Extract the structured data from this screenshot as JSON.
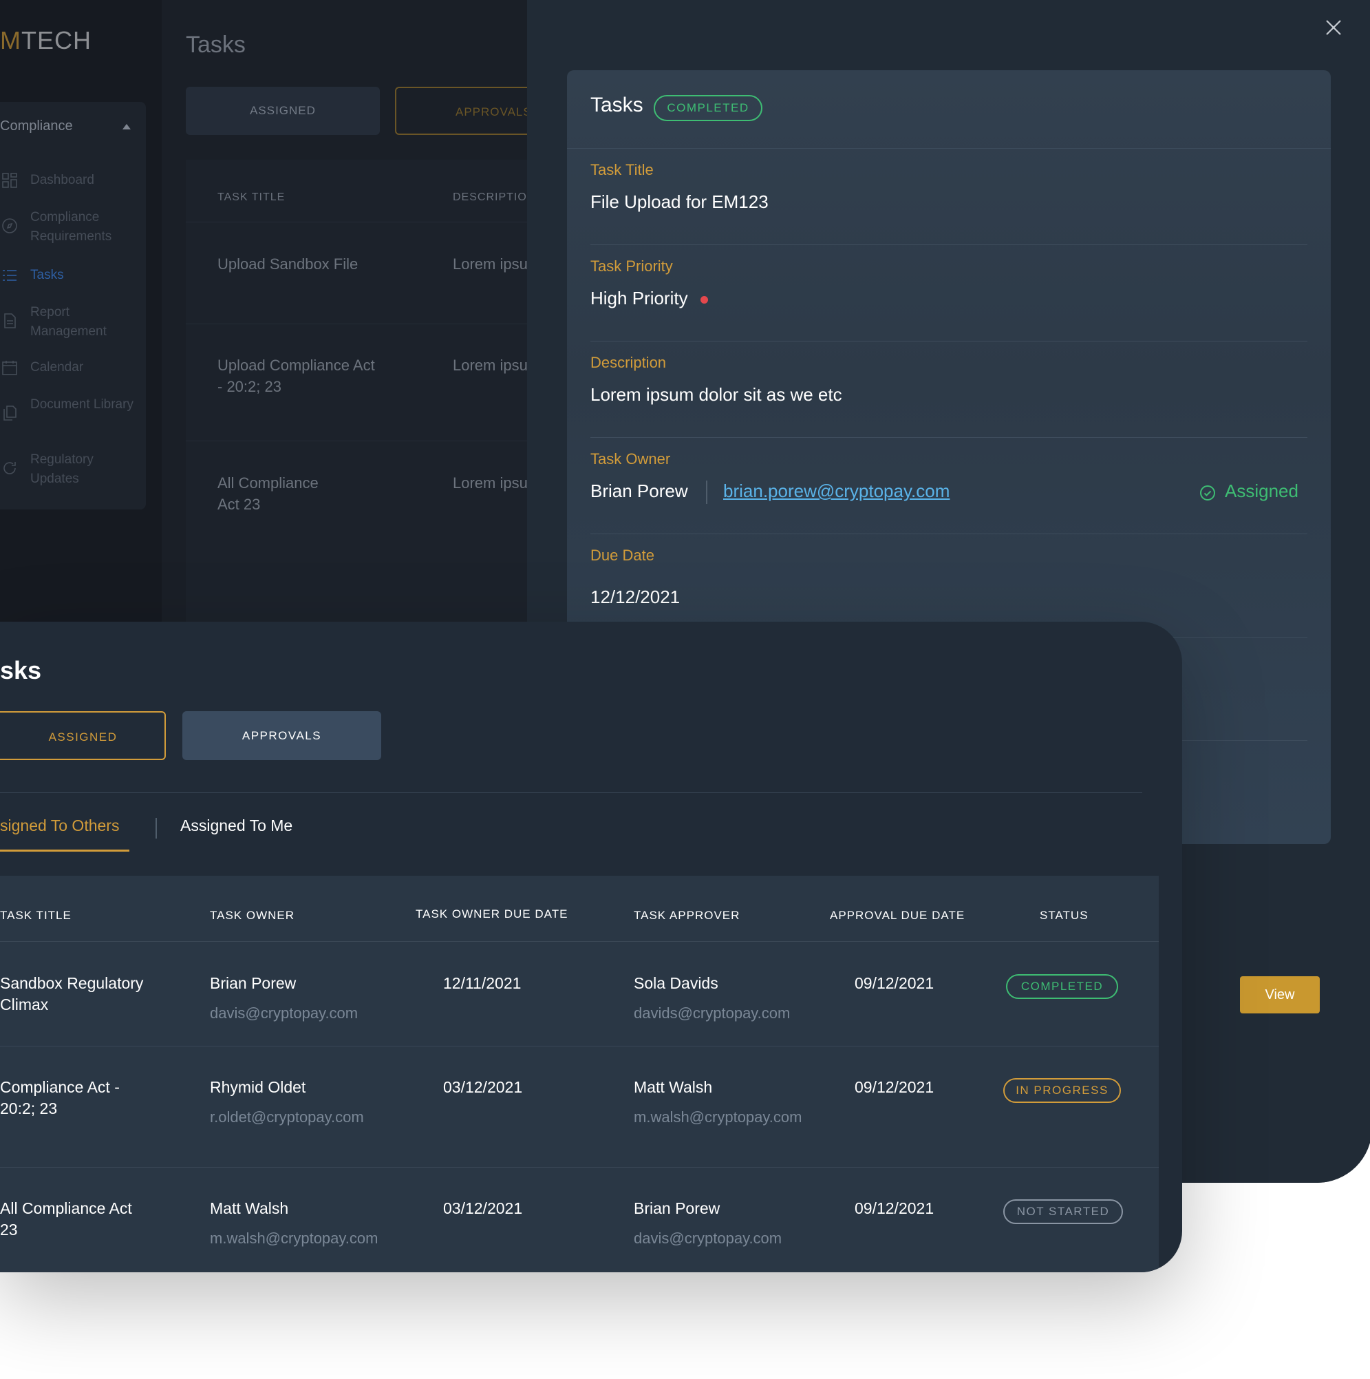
{
  "background": {
    "logo": {
      "mark": "M",
      "rest": "TECH"
    },
    "nav": {
      "header": "Compliance",
      "items": [
        {
          "label": "Dashboard",
          "icon": "dashboard-icon"
        },
        {
          "label": "Compliance Requirements",
          "icon": "compass-icon"
        },
        {
          "label": "Tasks",
          "icon": "list-icon",
          "active": true
        },
        {
          "label": "Report Management",
          "icon": "report-icon"
        },
        {
          "label": "Calendar",
          "icon": "calendar-icon"
        },
        {
          "label": "Document Library",
          "icon": "documents-icon"
        },
        {
          "label": "Regulatory Updates",
          "icon": "refresh-icon"
        }
      ]
    },
    "title": "Tasks",
    "tabs": [
      "ASSIGNED",
      "APPROVALS"
    ],
    "columns": [
      "TASK TITLE",
      "DESCRIPTION"
    ],
    "rows": [
      {
        "title": "Upload Sandbox File",
        "description": "Lorem ipsu"
      },
      {
        "title": "Upload Compliance Act - 20:2; 23",
        "description": "Lorem ipsu"
      },
      {
        "title": "All Compliance Act 23",
        "description": "Lorem ipsu"
      }
    ]
  },
  "detail": {
    "title": "Tasks",
    "status": "COMPLETED",
    "fields": {
      "task_title_label": "Task Title",
      "task_title": "File Upload for EM123",
      "priority_label": "Task Priority",
      "priority": "High Priority",
      "description_label": "Description",
      "description": "Lorem ipsum dolor sit as we etc",
      "owner_label": "Task Owner",
      "owner_name": "Brian Porew",
      "owner_email": "brian.porew@cryptopay.com",
      "owner_state": "Assigned",
      "due_label": "Due Date",
      "due_date": "12/12/2021"
    },
    "view_button": "View"
  },
  "tasks": {
    "title": "sks",
    "tabs": {
      "assigned": "ASSIGNED",
      "approvals": "APPROVALS"
    },
    "subtabs": {
      "others": "signed To Others",
      "me": "Assigned To Me"
    },
    "columns": [
      "TASK TITLE",
      "TASK OWNER",
      "TASK OWNER DUE DATE",
      "TASK APPROVER",
      "APPROVAL DUE DATE",
      "STATUS"
    ],
    "rows": [
      {
        "title": "Sandbox Regulatory Climax",
        "owner": "Brian Porew",
        "owner_email": "davis@cryptopay.com",
        "owner_due": "12/11/2021",
        "approver": "Sola Davids",
        "approver_email": "davids@cryptopay.com",
        "approval_due": "09/12/2021",
        "status": "COMPLETED",
        "status_color": "#3ebd73"
      },
      {
        "title": "Compliance Act - 20:2; 23",
        "owner": "Rhymid Oldet",
        "owner_email": "r.oldet@cryptopay.com",
        "owner_due": "03/12/2021",
        "approver": "Matt Walsh",
        "approver_email": "m.walsh@cryptopay.com",
        "approval_due": "09/12/2021",
        "status": "IN PROGRESS",
        "status_color": "#d29c3a"
      },
      {
        "title": "All Compliance Act 23",
        "owner": "Matt Walsh",
        "owner_email": "m.walsh@cryptopay.com",
        "owner_due": "03/12/2021",
        "approver": "Brian Porew",
        "approver_email": "davis@cryptopay.com",
        "approval_due": "09/12/2021",
        "status": "NOT STARTED",
        "status_color": "#8a95a3"
      }
    ]
  },
  "colors": {
    "accent": "#d29c3a",
    "success": "#3ebd73",
    "link": "#5ab3e8",
    "danger": "#e5484d"
  }
}
